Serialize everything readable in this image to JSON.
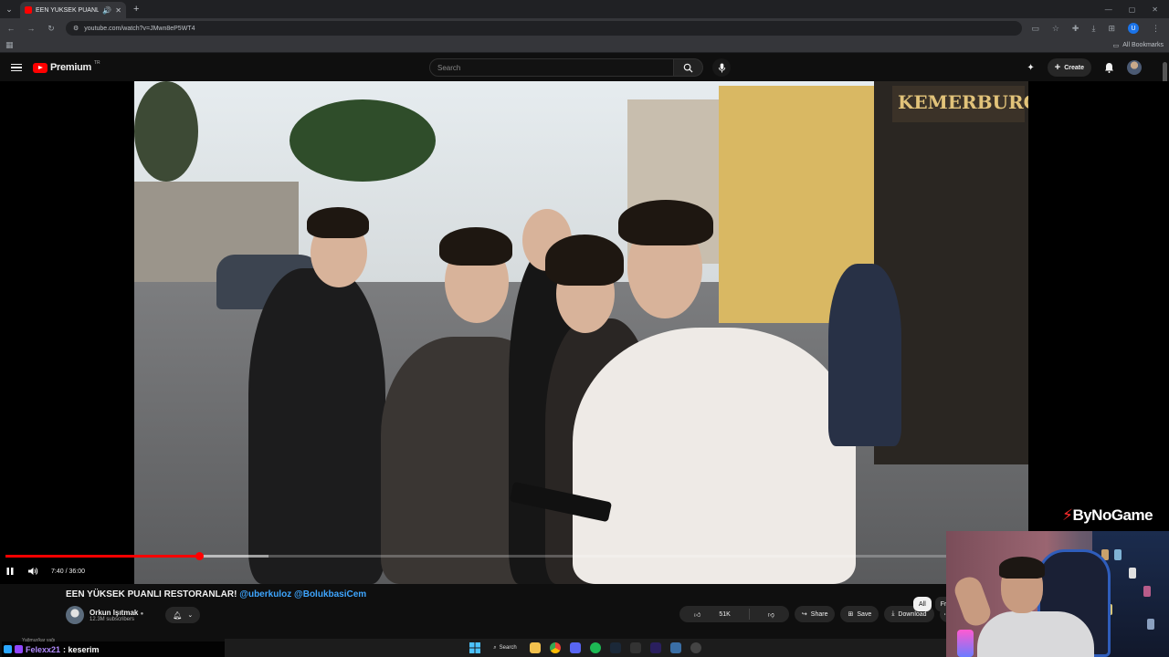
{
  "browser": {
    "tab_title": "EEN YÜKSEK PUANLI RESTO",
    "url": "youtube.com/watch?v=JMwn8eP5WT4",
    "all_bookmarks": "All Bookmarks",
    "profile_initial": "U"
  },
  "youtube": {
    "brand": "Premium",
    "country": "TR",
    "search_placeholder": "Search",
    "create_label": "Create"
  },
  "player": {
    "current_time": "7:40",
    "duration": "36:00",
    "time_display": "7:40 / 36:00",
    "progress_fraction": 0.2056,
    "buffered_fraction": 0.28,
    "watermark": "ByNoGame"
  },
  "video": {
    "title": "EEN YÜKSEK PUANLI RESTORANLAR!",
    "title_mentions": "@uberkuloz @BolukbasiCem",
    "channel_name": "Orkun Işıtmak",
    "subscribers": "12.3M subscribers",
    "likes": "51K",
    "share_label": "Share",
    "save_label": "Save",
    "download_label": "Download",
    "chips": [
      "All",
      "Fr"
    ]
  },
  "chat": {
    "prev_line": "Yağmur/kar yağı",
    "username": "Felexx21",
    "message": ": keserim"
  },
  "taskbar": {
    "search_label": "Search"
  },
  "colors": {
    "youtube_red": "#ff0000",
    "link_blue": "#3ea6ff",
    "background": "#0f0f0f"
  }
}
